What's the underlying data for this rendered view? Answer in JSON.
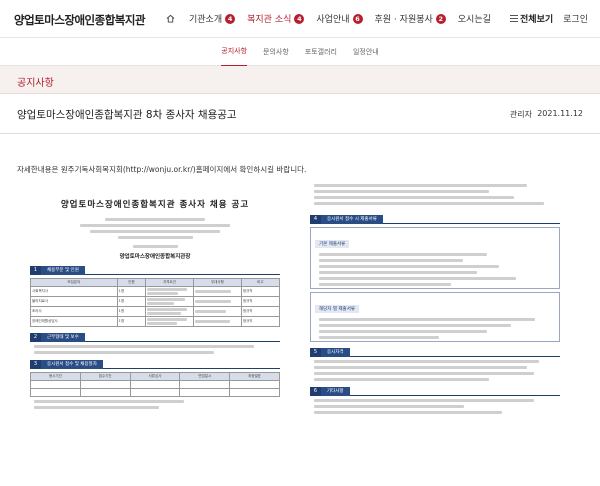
{
  "header": {
    "logo": "양업토마스장애인종합복지관",
    "home_icon": "home-icon",
    "nav": [
      {
        "label": "기관소개",
        "badge": "4",
        "active": false
      },
      {
        "label": "복지관 소식",
        "badge": "4",
        "active": true
      },
      {
        "label": "사업안내",
        "badge": "6",
        "active": false
      },
      {
        "label": "후원 · 자원봉사",
        "badge": "2",
        "active": false
      },
      {
        "label": "오시는길",
        "badge": "",
        "active": false
      }
    ],
    "all_menu": "전체보기",
    "login": "로그인",
    "accent": "#b5202e"
  },
  "subnav": [
    {
      "label": "공지사항",
      "active": true
    },
    {
      "label": "문의사항",
      "active": false
    },
    {
      "label": "포토갤러리",
      "active": false
    },
    {
      "label": "일정안내",
      "active": false
    }
  ],
  "page": {
    "title": "공지사항"
  },
  "post": {
    "title": "양업토마스장애인종합복지관 8차 종사자 채용공고",
    "author": "관리자",
    "date": "2021.11.12",
    "body": "자세한내용은 원주기독사회복지회(http://wonju.or.kr/)홈페이지에서 확인하시길 바랍니다."
  },
  "document": {
    "title": "양업토마스장애인종합복지관 종사자 채용 공고",
    "org": "양업토마스장애인종합복지관장",
    "sections_left": [
      "채용부문 및 인원",
      "근무형태 및 보수",
      "응시원서 접수 및 채용절차"
    ],
    "sections_right": [
      "응시원서 접수 시 제출서류",
      "응시자격",
      "기타사항"
    ],
    "box_heads": [
      "기본 제출서류",
      "해당자 별 제출서류"
    ],
    "table_head": [
      "모집분야",
      "인원",
      "자격요건",
      "우대사항",
      "비고"
    ],
    "rows": [
      [
        "사회복지사",
        "1명",
        "",
        "",
        "정규직"
      ],
      [
        "물리치료사",
        "1명",
        "",
        "",
        "정규직"
      ],
      [
        "조리사",
        "1명",
        "",
        "",
        "정규직"
      ],
      [
        "장애인재활상담사",
        "1명",
        "",
        "",
        "정규직"
      ]
    ],
    "table2_head": [
      "응시기간",
      "접수기간",
      "서류심사",
      "면접일시",
      "최종발표"
    ]
  }
}
